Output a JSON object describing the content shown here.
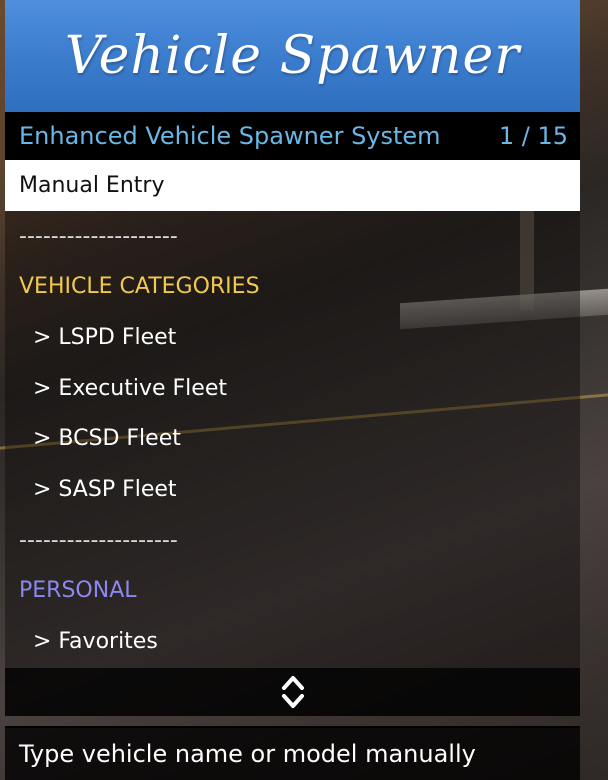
{
  "menu": {
    "banner_title": "Vehicle Spawner",
    "subtitle": "Enhanced Vehicle Spawner System",
    "page_counter": "1 / 15",
    "items": [
      {
        "label": "Manual Entry",
        "type": "action",
        "selected": true
      },
      {
        "label": "--------------------",
        "type": "separator"
      },
      {
        "label": "VEHICLE CATEGORIES",
        "type": "category"
      },
      {
        "label": "> LSPD Fleet",
        "type": "submenu"
      },
      {
        "label": "> Executive Fleet",
        "type": "submenu"
      },
      {
        "label": "> BCSD Fleet",
        "type": "submenu"
      },
      {
        "label": "> SASP Fleet",
        "type": "submenu"
      },
      {
        "label": "--------------------",
        "type": "separator"
      },
      {
        "label": "PERSONAL",
        "type": "category"
      },
      {
        "label": "> Favorites",
        "type": "submenu"
      }
    ],
    "scroll_icon": "up-down-arrows-icon",
    "description": "Type vehicle name or model manually"
  },
  "colors": {
    "banner": "#3a7bcc",
    "subtitle_text": "#6ab7e6",
    "vehicle_category": "#f2c94c",
    "personal_category": "#8b88f0",
    "selected_bg": "#ffffff"
  }
}
